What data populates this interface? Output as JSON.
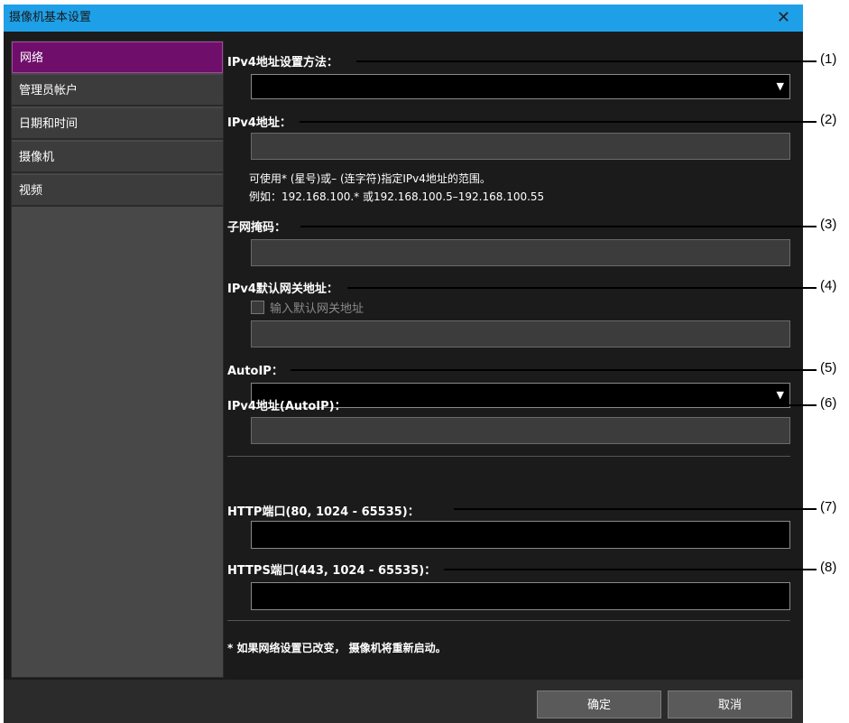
{
  "window": {
    "title": "摄像机基本设置",
    "close_glyph": "✕"
  },
  "sidebar": {
    "items": [
      {
        "label": "网络",
        "active": true
      },
      {
        "label": "管理员帐户"
      },
      {
        "label": "日期和时间"
      },
      {
        "label": "摄像机"
      },
      {
        "label": "视频"
      }
    ]
  },
  "form": {
    "ipv4_method_label": "IPv4地址设置方法：",
    "ipv4_method_value": "",
    "ipv4_address_label": "IPv4地址：",
    "ipv4_address_value": "",
    "ipv4_hint_line1": "可使用* (星号)或– (连字符)指定IPv4地址的范围。",
    "ipv4_hint_line2": "例如：192.168.100.* 或192.168.100.5–192.168.100.55",
    "subnet_label": "子网掩码：",
    "subnet_value": "",
    "gateway_label": "IPv4默认网关地址：",
    "gateway_checkbox_label": "输入默认网关地址",
    "gateway_checked": false,
    "gateway_value": "",
    "autoip_label": "AutoIP：",
    "autoip_value": "",
    "autoip_address_label": "IPv4地址(AutoIP)：",
    "autoip_address_value": "",
    "http_port_label": "HTTP端口(80, 1024 - 65535)：",
    "http_port_value": "",
    "https_port_label": "HTTPS端口(443, 1024 - 65535)：",
    "https_port_value": "",
    "footnote": "* 如果网络设置已改变， 摄像机将重新启动。"
  },
  "buttons": {
    "ok": "确定",
    "cancel": "取消"
  },
  "callouts": [
    "(1)",
    "(2)",
    "(3)",
    "(4)",
    "(5)",
    "(6)",
    "(7)",
    "(8)"
  ],
  "colors": {
    "title_bar": "#1ea0e8",
    "active_nav": "#6f0f6b",
    "dialog_bg": "#1b1b1b",
    "sidebar_bg": "#484848"
  }
}
